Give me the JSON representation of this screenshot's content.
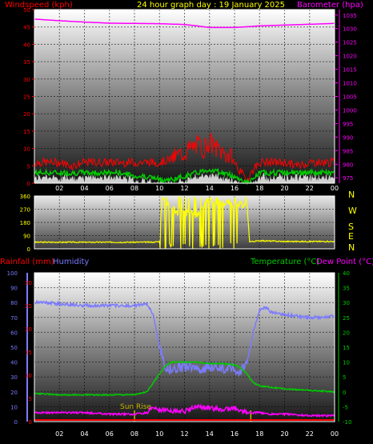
{
  "header": {
    "title": "24 hour graph day : 19 January 2025",
    "wind_label": "Windspeed (kph)",
    "baro_label": "Barometer (hpa)"
  },
  "colors": {
    "wind": "#ff0000",
    "gust_fill": "#ffffff",
    "avg_wind": "#00cc00",
    "baro": "#ff00ff",
    "winddir": "#ffff00",
    "rain": "#ff0000",
    "humidity": "#7b7bff",
    "temperature": "#00cc00",
    "dewpoint": "#ff00ff",
    "compass": "#ffff00",
    "axis": "#ffffff",
    "sunmark": "#c8b400"
  },
  "compass": [
    "N",
    "W",
    "S",
    "E",
    "N"
  ],
  "bottom_labels": {
    "rain": "Rainfall (mm)",
    "humidity": "Humidity",
    "temperature": "Temperature (°C)",
    "dewpoint": "Dew Point (°C)",
    "sunrise": "Sun Rise"
  },
  "chart_data": [
    {
      "type": "line",
      "name": "wind-baro",
      "title": "24 hour graph day : 19 January 2025",
      "x_ticks": [
        "02",
        "04",
        "06",
        "08",
        "10",
        "12",
        "14",
        "16",
        "18",
        "20",
        "22",
        "00"
      ],
      "xlim": [
        0,
        24
      ],
      "ylabel": "Windspeed (kph)",
      "ylim": [
        0,
        50
      ],
      "yticks": [
        0,
        5,
        10,
        15,
        20,
        25,
        30,
        35,
        40,
        45,
        50
      ],
      "y2label": "Barometer (hpa)",
      "y2lim": [
        973,
        1037
      ],
      "y2ticks": [
        975,
        980,
        985,
        990,
        995,
        1000,
        1005,
        1010,
        1015,
        1020,
        1025,
        1030,
        1035
      ],
      "grid": true,
      "series": [
        {
          "name": "Windspeed (kph)",
          "axis": "left",
          "x": [
            0,
            1,
            2,
            3,
            4,
            5,
            6,
            7,
            8,
            9,
            10,
            11,
            12,
            12.5,
            13,
            13.5,
            14,
            14.5,
            15,
            15.5,
            16,
            16.5,
            17,
            17.5,
            18,
            19,
            20,
            21,
            22,
            23,
            24
          ],
          "values": [
            6,
            6,
            6,
            5,
            6,
            6,
            6,
            6,
            6,
            6,
            6,
            7,
            9,
            10,
            11,
            10,
            12,
            10,
            9,
            8,
            6,
            3,
            1,
            4,
            6,
            6,
            6,
            5,
            6,
            6,
            6
          ]
        },
        {
          "name": "Average windspeed",
          "axis": "left",
          "x": [
            0,
            1,
            2,
            3,
            4,
            5,
            6,
            7,
            8,
            9,
            10,
            11,
            12,
            13,
            14,
            15,
            16,
            17,
            17.5,
            18,
            19,
            20,
            21,
            22,
            23,
            24
          ],
          "values": [
            3,
            3,
            3,
            3,
            3,
            3,
            3,
            3,
            2,
            2,
            1,
            1,
            2,
            3,
            4,
            3,
            2,
            0,
            1,
            3,
            3,
            3,
            3,
            3,
            3,
            3
          ]
        },
        {
          "name": "Barometer (hpa)",
          "axis": "right",
          "x": [
            0,
            2,
            4,
            6,
            8,
            10,
            12,
            13,
            14,
            16,
            17,
            18,
            20,
            22,
            24
          ],
          "values": [
            1033.5,
            1032.9,
            1032.4,
            1032.0,
            1031.9,
            1031.8,
            1031.5,
            1031.0,
            1030.4,
            1030.4,
            1030.7,
            1031.0,
            1031.3,
            1031.6,
            1031.9
          ]
        }
      ]
    },
    {
      "type": "line",
      "name": "wind-direction",
      "xlim": [
        0,
        24
      ],
      "ylim": [
        0,
        360
      ],
      "yticks": [
        0,
        90,
        180,
        270,
        360
      ],
      "grid": true,
      "series": [
        {
          "name": "Wind direction",
          "x": [
            0,
            2,
            4,
            6,
            8,
            9.5,
            10,
            10.2,
            10.5,
            11,
            11.5,
            12,
            12.5,
            13,
            13.5,
            14,
            14.5,
            15,
            15.5,
            16,
            17,
            17.2,
            17.5,
            18,
            20,
            22,
            24
          ],
          "values": [
            45,
            45,
            45,
            45,
            45,
            45,
            50,
            350,
            320,
            290,
            240,
            250,
            240,
            230,
            300,
            330,
            320,
            310,
            320,
            300,
            300,
            50,
            50,
            55,
            50,
            50,
            50
          ]
        }
      ]
    },
    {
      "type": "line",
      "name": "temp-hum-rain",
      "x_ticks": [
        "02",
        "04",
        "06",
        "08",
        "10",
        "12",
        "14",
        "16",
        "18",
        "20",
        "22",
        "00"
      ],
      "xlim": [
        0,
        24
      ],
      "ylim": [
        0,
        100
      ],
      "yticks": [
        0,
        10,
        20,
        30,
        40,
        50,
        60,
        70,
        80,
        90,
        100
      ],
      "y_rain_ticks": [
        0,
        5,
        10,
        15,
        20,
        25,
        30
      ],
      "y2lim": [
        -10,
        40
      ],
      "y2ticks": [
        -10,
        -5,
        0,
        5,
        10,
        15,
        20,
        25,
        30,
        35,
        40
      ],
      "grid": true,
      "sunrise_hour": 8,
      "sunset_hour": 17.3,
      "series": [
        {
          "name": "Humidity",
          "axis": "left",
          "x": [
            0,
            1,
            2,
            4,
            6,
            8,
            9,
            9.5,
            10,
            10.5,
            11,
            12,
            13,
            14,
            15,
            16,
            16.5,
            17,
            17.5,
            18,
            18.5,
            19,
            20,
            21,
            22,
            23,
            24
          ],
          "values": [
            80,
            80,
            79,
            78,
            78,
            78,
            79,
            72,
            50,
            36,
            35,
            37,
            35,
            37,
            36,
            36,
            33,
            40,
            60,
            75,
            77,
            73,
            72,
            71,
            70,
            70,
            71
          ]
        },
        {
          "name": "Temperature (°C)",
          "axis": "right",
          "x": [
            0,
            2,
            4,
            6,
            8,
            9,
            10,
            10.5,
            11,
            12,
            13,
            14,
            15,
            16,
            16.5,
            17,
            17.5,
            18,
            19,
            20,
            22,
            24
          ],
          "values": [
            -0.5,
            -1,
            -1,
            -1,
            -1,
            0,
            6,
            9,
            10,
            10,
            10,
            9.5,
            9.5,
            9,
            8,
            6,
            3,
            2,
            1.5,
            1,
            0.5,
            0
          ]
        },
        {
          "name": "Dew Point (°C)",
          "axis": "right",
          "x": [
            0,
            2,
            4,
            6,
            8,
            9,
            9.5,
            10,
            11,
            12,
            13,
            14,
            15,
            16,
            17,
            18,
            19,
            20,
            22,
            24
          ],
          "values": [
            -7,
            -7,
            -7,
            -7.5,
            -7.5,
            -7,
            -5,
            -6,
            -6.5,
            -6.5,
            -5,
            -5.5,
            -6,
            -5.5,
            -7,
            -7,
            -7.5,
            -7.5,
            -8,
            -8
          ]
        },
        {
          "name": "Rainfall (mm)",
          "axis": "rain",
          "x": [
            0,
            24
          ],
          "values": [
            0,
            0
          ]
        }
      ]
    }
  ]
}
